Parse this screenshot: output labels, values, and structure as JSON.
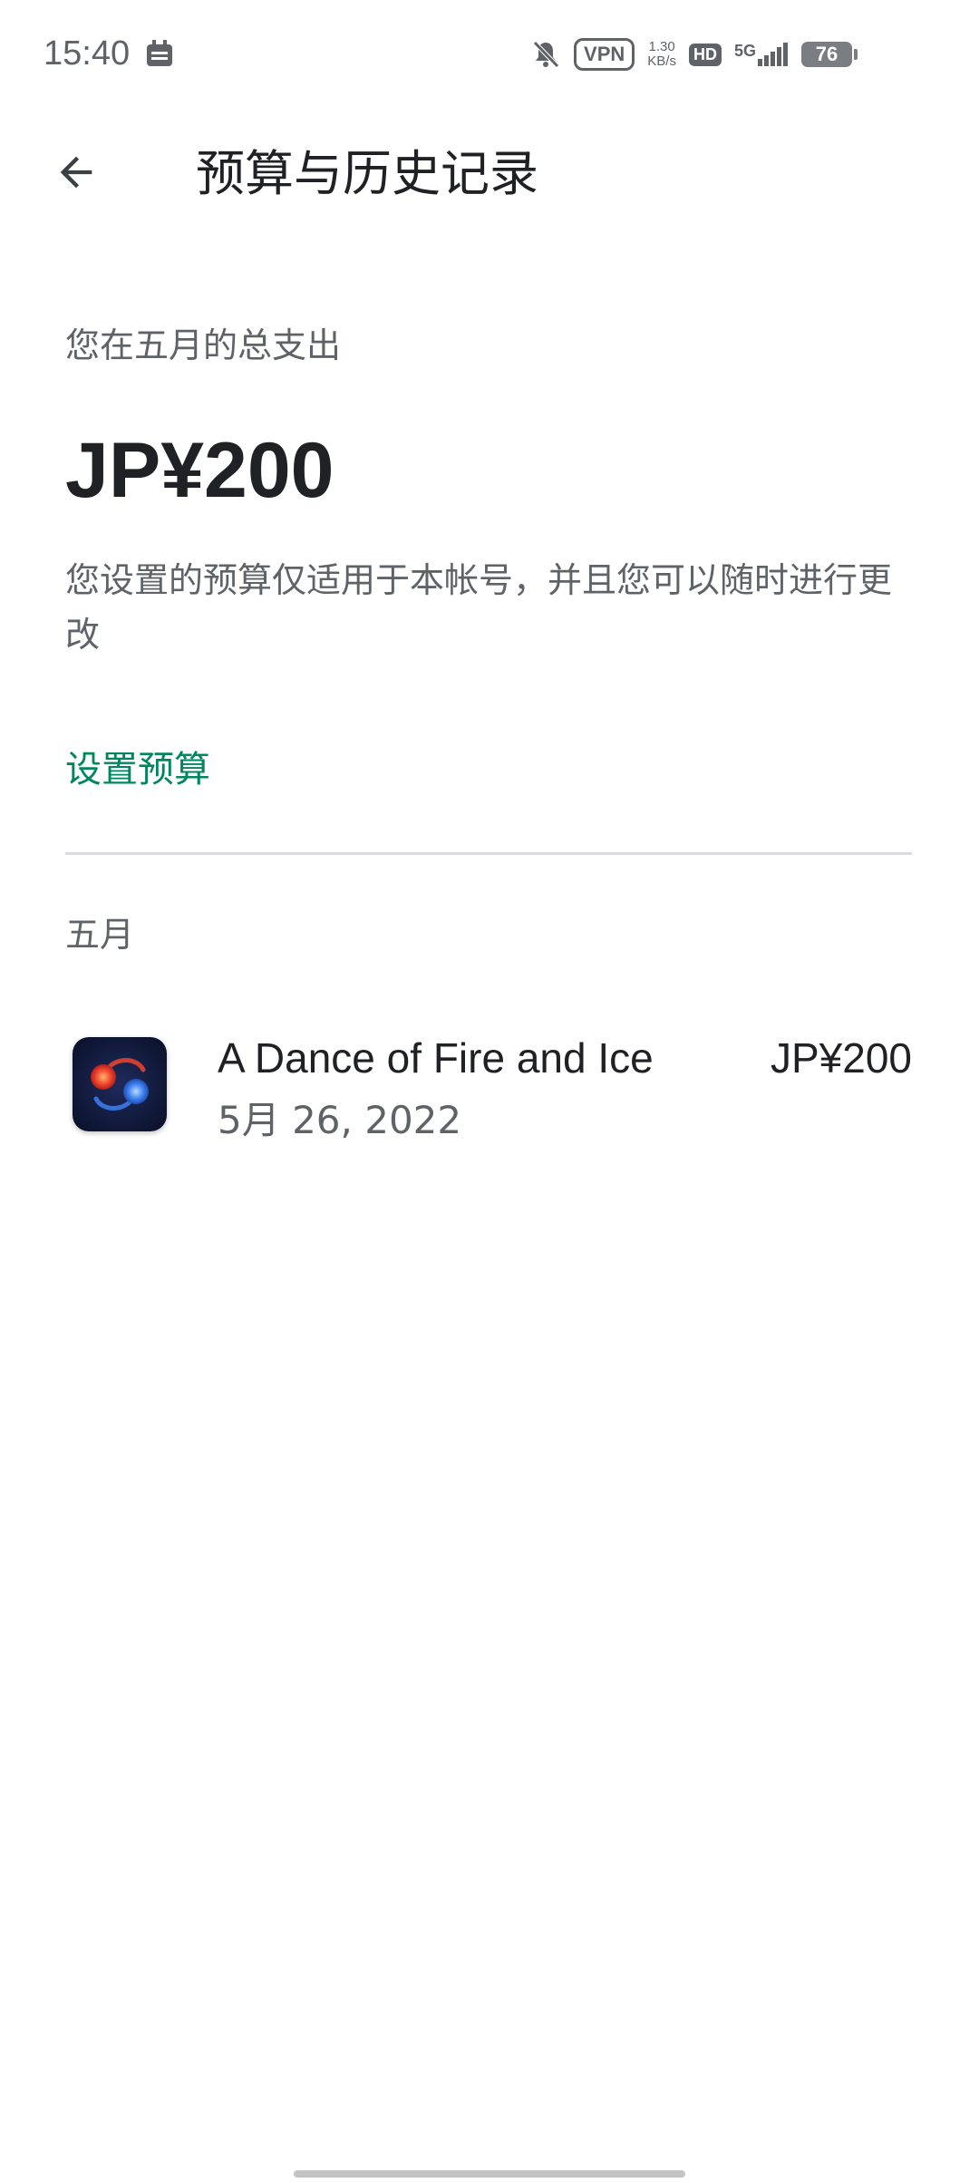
{
  "status_bar": {
    "time": "15:40",
    "vpn": "VPN",
    "speed_value": "1.30",
    "speed_unit": "KB/s",
    "hd": "HD",
    "network": "5G",
    "battery": "76"
  },
  "header": {
    "title": "预算与历史记录"
  },
  "summary": {
    "label": "您在五月的总支出",
    "amount": "JP¥200",
    "note": "您设置的预算仅适用于本帐号，并且您可以随时进行更改",
    "set_budget_label": "设置预算"
  },
  "history": {
    "month": "五月",
    "items": [
      {
        "name": "A Dance of Fire and Ice",
        "date": "5月 26, 2022",
        "amount": "JP¥200",
        "icon": "game-app-icon"
      }
    ]
  },
  "colors": {
    "accent": "#01875f",
    "text_primary": "#202124",
    "text_secondary": "#5f6368"
  }
}
